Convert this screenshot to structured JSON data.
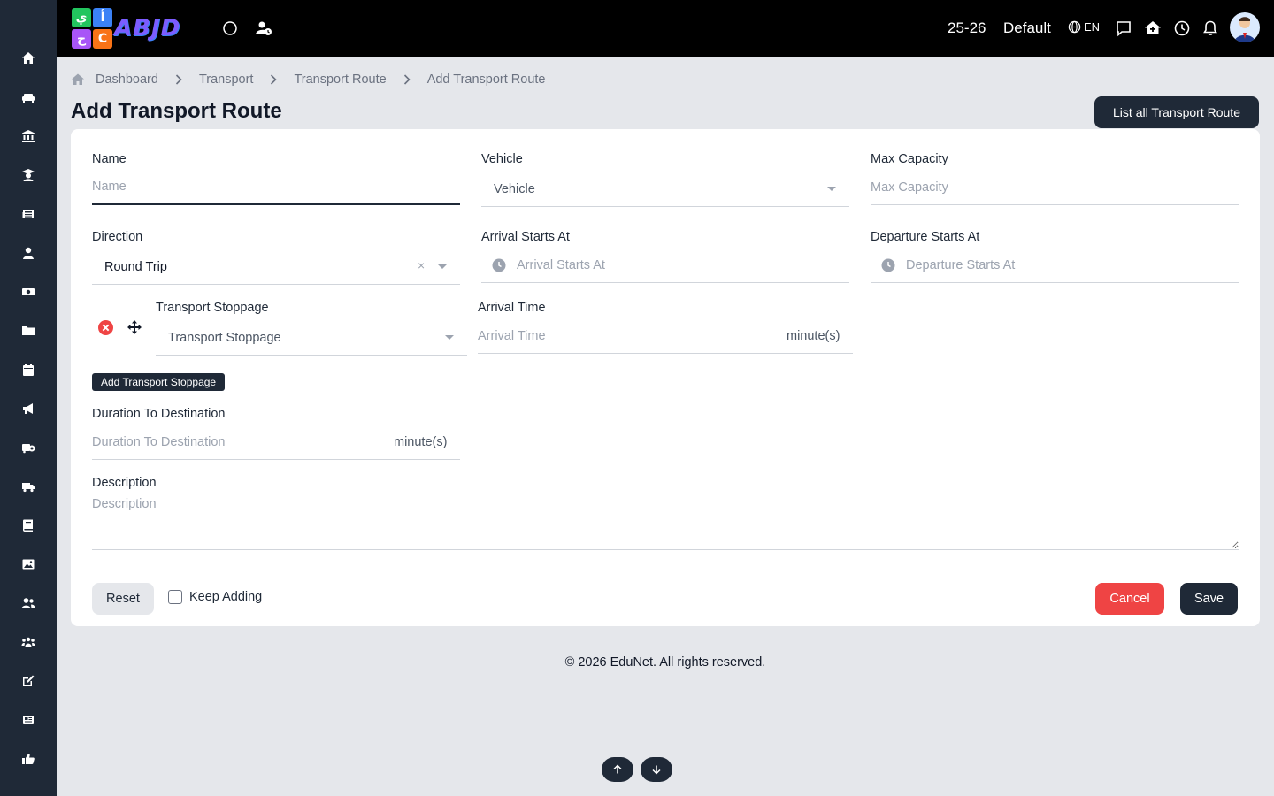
{
  "app": {
    "logo_text": "ABJD",
    "logo_tiles": [
      "ي",
      "أ",
      "ج",
      "C"
    ]
  },
  "header": {
    "session": "25-26",
    "profile": "Default",
    "language": "EN"
  },
  "sidebar": {
    "items": [
      {
        "icon": "home-icon"
      },
      {
        "icon": "sofa-icon"
      },
      {
        "icon": "bank-icon"
      },
      {
        "icon": "graduate-icon"
      },
      {
        "icon": "newspaper-icon"
      },
      {
        "icon": "user-icon"
      },
      {
        "icon": "money-icon"
      },
      {
        "icon": "folder-icon"
      },
      {
        "icon": "calendar-icon"
      },
      {
        "icon": "megaphone-icon"
      },
      {
        "icon": "bus-school-icon"
      },
      {
        "icon": "truck-icon"
      },
      {
        "icon": "book-icon"
      },
      {
        "icon": "image-icon"
      },
      {
        "icon": "users-icon"
      },
      {
        "icon": "group-icon"
      },
      {
        "icon": "edit-icon"
      },
      {
        "icon": "news-icon"
      },
      {
        "icon": "thumbs-up-icon"
      }
    ]
  },
  "breadcrumb": [
    "Dashboard",
    "Transport",
    "Transport Route",
    "Add Transport Route"
  ],
  "page": {
    "title": "Add Transport Route",
    "list_button": "List all Transport Route"
  },
  "form": {
    "name": {
      "label": "Name",
      "placeholder": "Name"
    },
    "vehicle": {
      "label": "Vehicle",
      "placeholder": "Vehicle"
    },
    "max_capacity": {
      "label": "Max Capacity",
      "placeholder": "Max Capacity"
    },
    "direction": {
      "label": "Direction",
      "value": "Round Trip",
      "clear": "×"
    },
    "arrival_starts_at": {
      "label": "Arrival Starts At",
      "placeholder": "Arrival Starts At"
    },
    "departure_starts_at": {
      "label": "Departure Starts At",
      "placeholder": "Departure Starts At"
    },
    "stoppage": {
      "label": "Transport Stoppage",
      "placeholder": "Transport Stoppage"
    },
    "arrival_time": {
      "label": "Arrival Time",
      "placeholder": "Arrival Time",
      "suffix": "minute(s)"
    },
    "add_stoppage_button": "Add Transport Stoppage",
    "duration": {
      "label": "Duration To Destination",
      "placeholder": "Duration To Destination",
      "suffix": "minute(s)"
    },
    "description": {
      "label": "Description",
      "placeholder": "Description"
    },
    "reset_button": "Reset",
    "keep_adding": "Keep Adding",
    "cancel_button": "Cancel",
    "save_button": "Save"
  },
  "footer": {
    "text": "© 2026 EduNet. All rights reserved."
  },
  "colors": {
    "primary": "#1f2937",
    "danger": "#ef4444",
    "background": "#e5e7eb"
  }
}
